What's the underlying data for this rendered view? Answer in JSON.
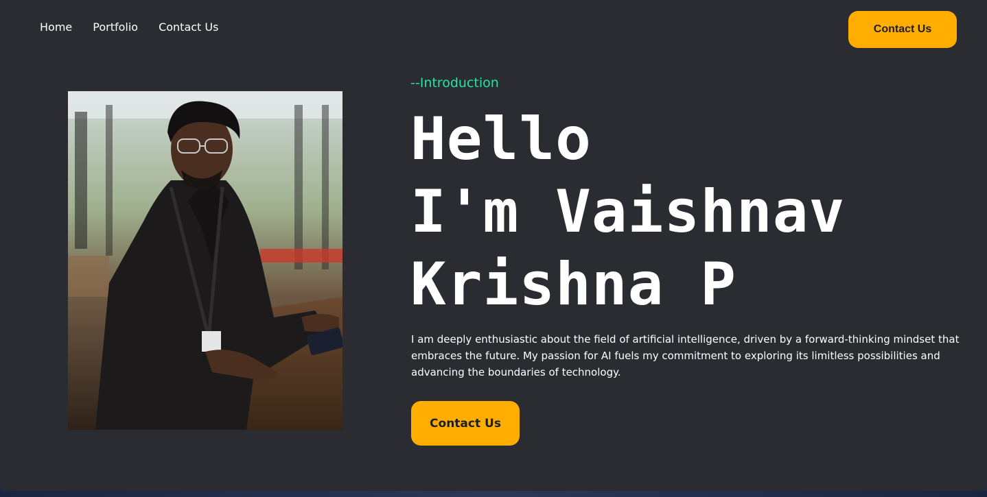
{
  "nav": {
    "items": [
      {
        "label": "Home"
      },
      {
        "label": "Portfolio"
      },
      {
        "label": "Contact Us"
      }
    ],
    "cta_label": "Contact Us"
  },
  "hero": {
    "intro": "--Introduction",
    "headline_lines": [
      "Hello",
      "I'm Vaishnav",
      "Krishna P"
    ],
    "description": "I am deeply enthusiastic about the field of artificial intelligence, driven by a forward-thinking mindset that embraces the future. My passion for AI fuels my commitment to exploring its limitless possibilities and advancing the boundaries of technology.",
    "cta_label": "Contact Us"
  },
  "colors": {
    "background": "#2b2c31",
    "accent": "#ffad00",
    "intro_text": "#1de9a0",
    "text": "#ffffff"
  }
}
